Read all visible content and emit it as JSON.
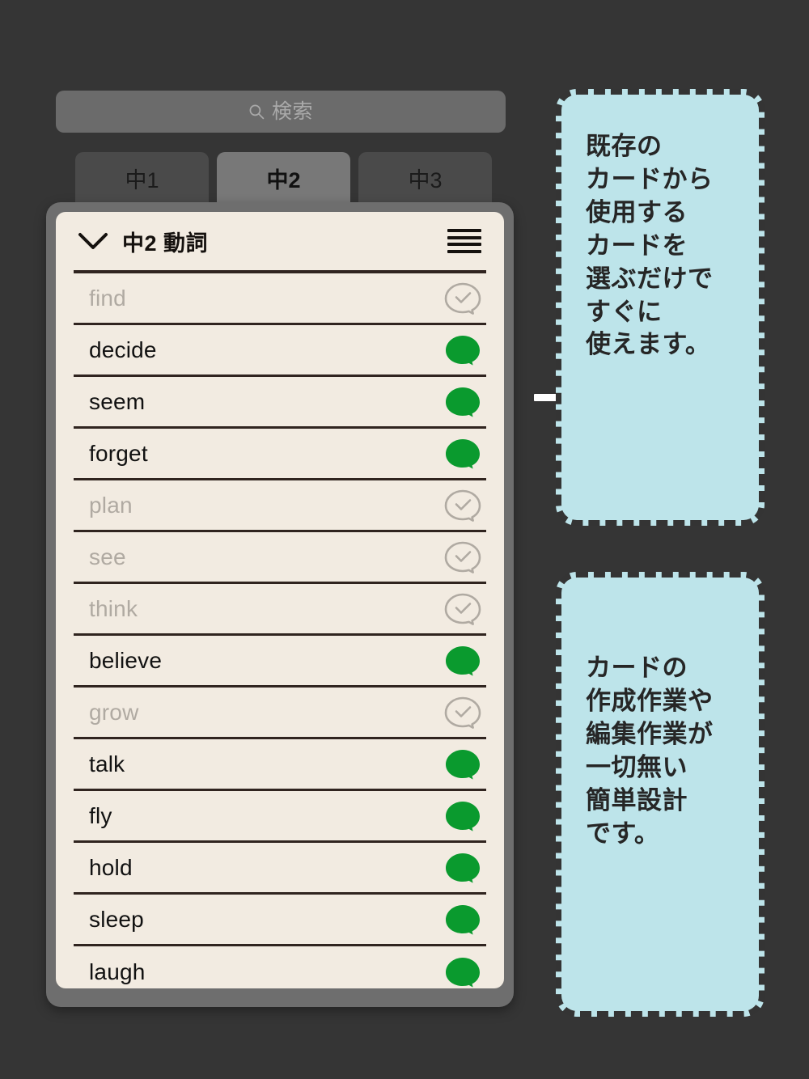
{
  "search": {
    "icon": "search-icon",
    "placeholder": "検索",
    "value": ""
  },
  "tabs": [
    {
      "label": "中1",
      "active": false
    },
    {
      "label": "中2",
      "active": true
    },
    {
      "label": "中3",
      "active": false
    }
  ],
  "card": {
    "chevron_icon": "chevron-down-icon",
    "title": "中2 動詞",
    "menu_icon": "hamburger-menu-icon"
  },
  "words": [
    {
      "label": "find",
      "state": "off",
      "icon": "speech-bubble-check-icon"
    },
    {
      "label": "decide",
      "state": "on",
      "icon": "speech-bubble-filled-icon"
    },
    {
      "label": "seem",
      "state": "on",
      "icon": "speech-bubble-filled-icon"
    },
    {
      "label": "forget",
      "state": "on",
      "icon": "speech-bubble-filled-icon"
    },
    {
      "label": "plan",
      "state": "off",
      "icon": "speech-bubble-check-icon"
    },
    {
      "label": "see",
      "state": "off",
      "icon": "speech-bubble-check-icon"
    },
    {
      "label": "think",
      "state": "off",
      "icon": "speech-bubble-check-icon"
    },
    {
      "label": "believe",
      "state": "on",
      "icon": "speech-bubble-filled-icon"
    },
    {
      "label": "grow",
      "state": "off",
      "icon": "speech-bubble-check-icon"
    },
    {
      "label": "talk",
      "state": "on",
      "icon": "speech-bubble-filled-icon"
    },
    {
      "label": "fly",
      "state": "on",
      "icon": "speech-bubble-filled-icon"
    },
    {
      "label": "hold",
      "state": "on",
      "icon": "speech-bubble-filled-icon"
    },
    {
      "label": "sleep",
      "state": "on",
      "icon": "speech-bubble-filled-icon"
    },
    {
      "label": "laugh",
      "state": "on",
      "icon": "speech-bubble-filled-icon"
    }
  ],
  "callouts": [
    {
      "lines": [
        "既存の",
        "カードから",
        "使用する",
        "カードを",
        "選ぶだけで",
        "すぐに",
        "使えます。"
      ]
    },
    {
      "lines": [
        "カードの",
        "作成作業や",
        "編集作業が",
        "一切無い",
        "簡単設計",
        "です。"
      ]
    }
  ],
  "colors": {
    "background": "#353535",
    "card_surface": "#f2ebe1",
    "rule": "#30241f",
    "bubble_on": "#0a9a2e",
    "bubble_off": "#b0aaa2",
    "callout_fill": "#bde4ea",
    "callout_border": "#343434",
    "tab_active": "#787878",
    "tab_inactive": "#4a4a4a",
    "search_field": "#6b6b6b"
  }
}
